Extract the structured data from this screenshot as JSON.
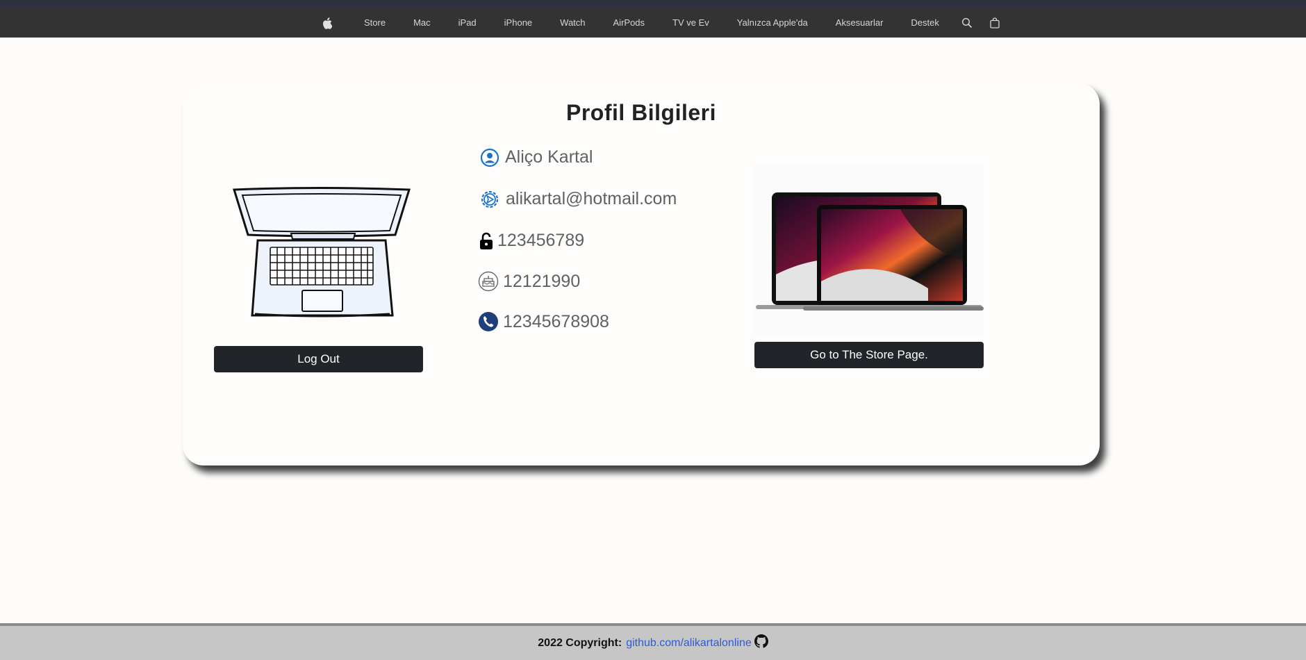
{
  "nav": {
    "items": [
      "Store",
      "Mac",
      "iPad",
      "iPhone",
      "Watch",
      "AirPods",
      "TV ve Ev",
      "Yalnızca Apple'da",
      "Aksesuarlar",
      "Destek"
    ]
  },
  "profile": {
    "title": "Profil Bilgileri",
    "name": "Aliço Kartal",
    "email": "alikartal@hotmail.com",
    "password": "123456789",
    "birthdate": "12121990",
    "phone": "12345678908",
    "logout_label": "Log Out",
    "store_label": "Go to The Store Page."
  },
  "footer": {
    "copyright": "2022 Copyright:",
    "link": "github.com/alikartalonline"
  },
  "colors": {
    "nav_bg": "#333333",
    "button_bg": "#212529",
    "link": "#2c5bd8",
    "icon_blue": "#1a73c8"
  }
}
